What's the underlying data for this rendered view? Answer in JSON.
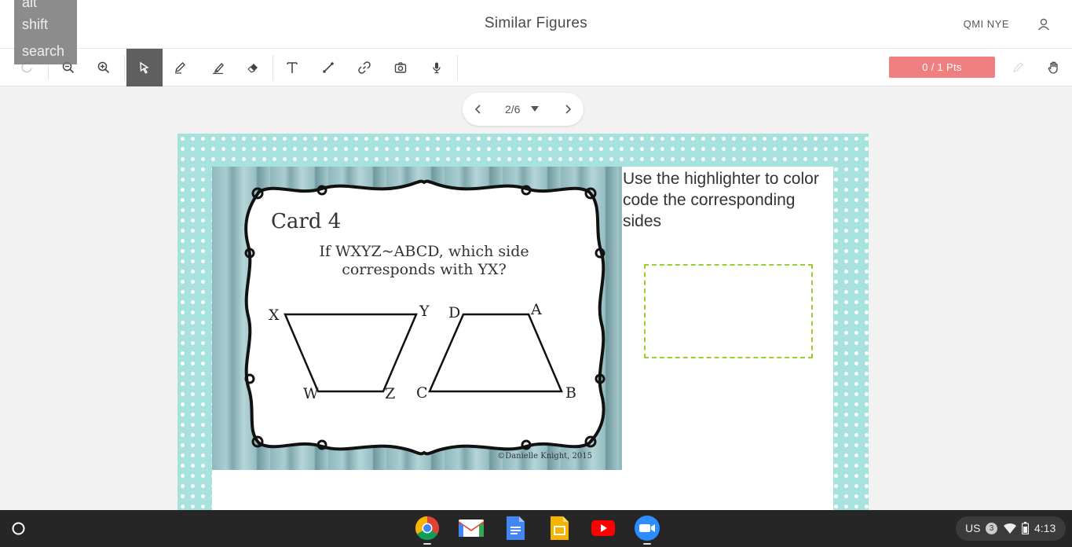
{
  "header": {
    "title": "Similar Figures",
    "user_name": "QMI NYE"
  },
  "keyboard_overlay": {
    "keys": [
      "alt",
      "shift",
      "search"
    ]
  },
  "toolbar": {
    "points_label": "0 / 1 Pts",
    "tools": [
      "undo-icon",
      "zoom-out-icon",
      "zoom-in-icon",
      "select-icon",
      "pen-icon",
      "highlighter-icon",
      "eraser-icon",
      "text-icon",
      "line-icon",
      "link-icon",
      "camera-icon",
      "mic-icon"
    ]
  },
  "pager": {
    "page_label": "2/6"
  },
  "slide": {
    "instruction": "Use the highlighter to color code the corresponding sides",
    "card": {
      "title": "Card 4",
      "question_line1": "If WXYZ~ABCD, which side",
      "question_line2": "corresponds with YX?",
      "copyright": "©Danielle Knight, 2015",
      "labels": {
        "x": "X",
        "y": "Y",
        "w": "W",
        "z": "Z",
        "d": "D",
        "a": "A",
        "c": "C",
        "b": "B"
      }
    }
  },
  "shelf": {
    "apps": [
      "chrome-icon",
      "gmail-icon",
      "docs-icon",
      "slides-icon",
      "youtube-icon",
      "zoom-icon"
    ],
    "locale": "US",
    "notification_count": "3",
    "time": "4:13"
  },
  "colors": {
    "accent_points": "#f08080",
    "slide_border": "#a8e2df",
    "dropzone_border": "#9acd32",
    "active_tool": "#5f5f5f"
  }
}
